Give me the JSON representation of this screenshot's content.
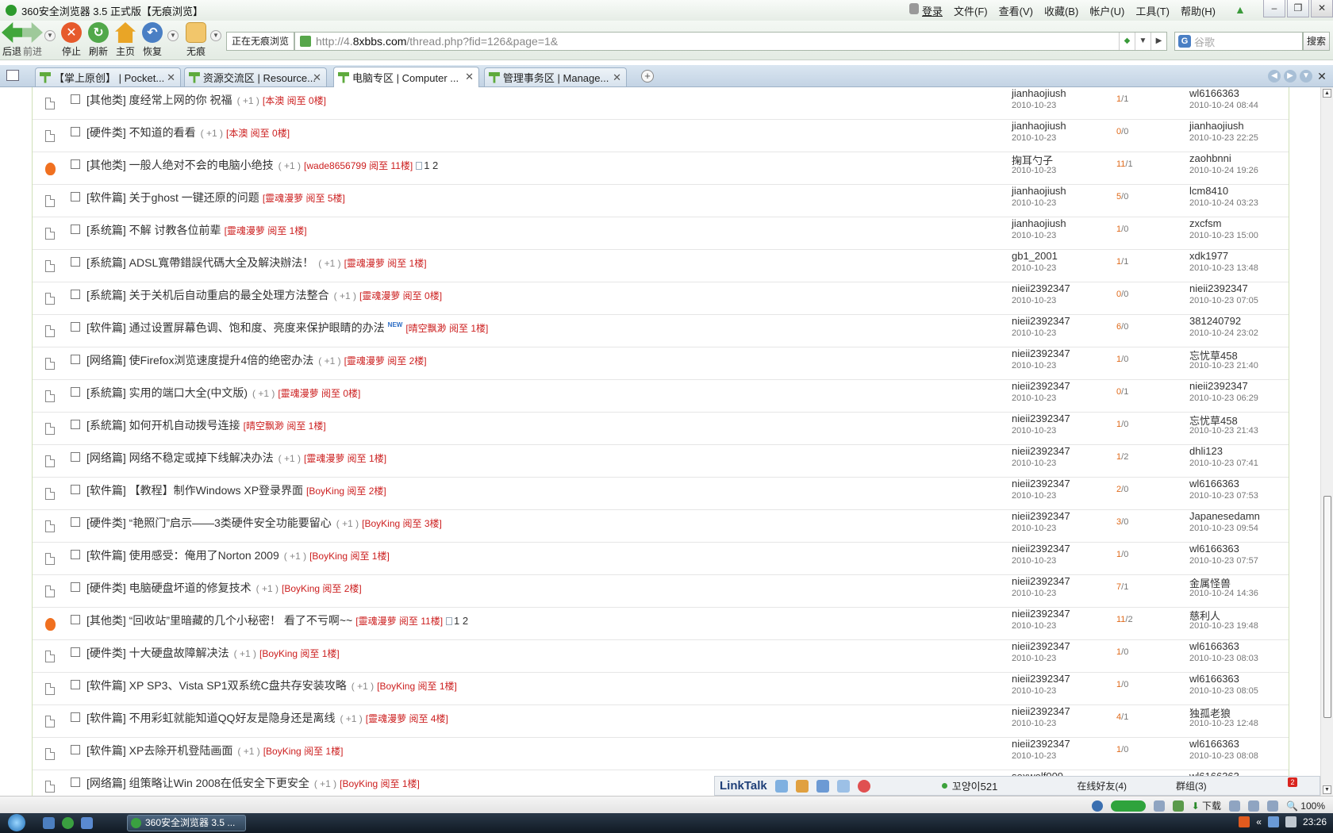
{
  "window": {
    "title": "360安全浏览器 3.5 正式版【无痕浏览】",
    "menus": [
      "登录",
      "文件(F)",
      "查看(V)",
      "收藏(B)",
      "帐户(U)",
      "工具(T)",
      "帮助(H)"
    ]
  },
  "toolbar": {
    "back": "后退",
    "forward": "前进",
    "stop": "停止",
    "refresh": "刷新",
    "home": "主页",
    "restore": "恢复",
    "traceless": "无痕",
    "incognito_badge": "正在无痕浏览",
    "url_prefix": "http://4.",
    "url_domain": "8xbbs.com",
    "url_path": "/thread.php?fid=126&page=1&",
    "search_placeholder": "谷歌",
    "search_button": "搜索"
  },
  "tabs": [
    {
      "label": "【掌上原创】 | Pocket...",
      "active": false
    },
    {
      "label": "资源交流区 | Resource...",
      "active": false
    },
    {
      "label": "电脑专区 | Computer ...",
      "active": true
    },
    {
      "label": "管理事务区 | Manage...",
      "active": false
    }
  ],
  "threads": [
    {
      "hot": false,
      "cat": "[其他类]",
      "subject": "度经常上网的你  祝福",
      "plus": "( +1 )",
      "lastread": "[本澳 阅至 0楼]",
      "pages": "",
      "new": false,
      "author": "jianhaojiush",
      "adate": "2010-10-23",
      "replies": "1",
      "views": "1",
      "lastuser": "wl6166363",
      "ldate": "2010-10-24 08:44"
    },
    {
      "hot": false,
      "cat": "[硬件类]",
      "subject": "不知道的看看",
      "plus": "( +1 )",
      "lastread": "[本澳 阅至 0楼]",
      "pages": "",
      "new": false,
      "author": "jianhaojiush",
      "adate": "2010-10-23",
      "replies": "0",
      "views": "0",
      "lastuser": "jianhaojiush",
      "ldate": "2010-10-23 22:25"
    },
    {
      "hot": true,
      "cat": "[其他类]",
      "subject": "一般人绝对不会的电脑小绝技",
      "plus": "( +1 )",
      "lastread": "[wade8656799 阅至 11楼]",
      "pages": "1 2",
      "new": false,
      "author": "掬耳勺子",
      "adate": "2010-10-23",
      "replies": "11",
      "views": "1",
      "lastuser": "zaohbnni",
      "ldate": "2010-10-24 19:26"
    },
    {
      "hot": false,
      "cat": "[软件篇]",
      "subject": "关于ghost  一键还原的问题",
      "plus": "",
      "lastread": "[靈魂漫萝 阅至 5楼]",
      "pages": "",
      "new": false,
      "author": "jianhaojiush",
      "adate": "2010-10-23",
      "replies": "5",
      "views": "0",
      "lastuser": "lcm8410",
      "ldate": "2010-10-24 03:23"
    },
    {
      "hot": false,
      "cat": "[系统篇]",
      "subject": "不解  讨教各位前辈",
      "plus": "",
      "lastread": "[靈魂漫萝 阅至 1楼]",
      "pages": "",
      "new": false,
      "author": "jianhaojiush",
      "adate": "2010-10-23",
      "replies": "1",
      "views": "0",
      "lastuser": "zxcfsm",
      "ldate": "2010-10-23 15:00"
    },
    {
      "hot": false,
      "cat": "[系統篇]",
      "subject": "ADSL寬帶錯誤代碼大全及解決辦法！",
      "plus": "( +1 )",
      "lastread": "[靈魂漫萝 阅至 1楼]",
      "pages": "",
      "new": false,
      "author": "gb1_2001",
      "adate": "2010-10-23",
      "replies": "1",
      "views": "1",
      "lastuser": "xdk1977",
      "ldate": "2010-10-23 13:48"
    },
    {
      "hot": false,
      "cat": "[系統篇]",
      "subject": "关于关机后自动重启的最全处理方法整合",
      "plus": "( +1 )",
      "lastread": "[靈魂漫萝 阅至 0楼]",
      "pages": "",
      "new": false,
      "author": "nieii2392347",
      "adate": "2010-10-23",
      "replies": "0",
      "views": "0",
      "lastuser": "nieii2392347",
      "ldate": "2010-10-23 07:05"
    },
    {
      "hot": false,
      "cat": "[软件篇]",
      "subject": "通过设置屏幕色调、饱和度、亮度来保护眼睛的办法",
      "plus": "",
      "lastread": "[晴空飘渺 阅至 1楼]",
      "pages": "",
      "new": true,
      "author": "nieii2392347",
      "adate": "2010-10-23",
      "replies": "6",
      "views": "0",
      "lastuser": "381240792",
      "ldate": "2010-10-24 23:02"
    },
    {
      "hot": false,
      "cat": "[网络篇]",
      "subject": "使Firefox浏览速度提升4倍的绝密办法",
      "plus": "( +1 )",
      "lastread": "[靈魂漫萝 阅至 2楼]",
      "pages": "",
      "new": false,
      "author": "nieii2392347",
      "adate": "2010-10-23",
      "replies": "1",
      "views": "0",
      "lastuser": "忘忧草458",
      "ldate": "2010-10-23 21:40"
    },
    {
      "hot": false,
      "cat": "[系統篇]",
      "subject": "实用的端口大全(中文版)",
      "plus": "( +1 )",
      "lastread": "[靈魂漫萝 阅至 0楼]",
      "pages": "",
      "new": false,
      "author": "nieii2392347",
      "adate": "2010-10-23",
      "replies": "0",
      "views": "1",
      "lastuser": "nieii2392347",
      "ldate": "2010-10-23 06:29"
    },
    {
      "hot": false,
      "cat": "[系統篇]",
      "subject": "如何开机自动拨号连接",
      "plus": "",
      "lastread": "[晴空飘渺 阅至 1楼]",
      "pages": "",
      "new": false,
      "author": "nieii2392347",
      "adate": "2010-10-23",
      "replies": "1",
      "views": "0",
      "lastuser": "忘忧草458",
      "ldate": "2010-10-23 21:43"
    },
    {
      "hot": false,
      "cat": "[网络篇]",
      "subject": "网络不稳定或掉下线解决办法",
      "plus": "( +1 )",
      "lastread": "[靈魂漫萝 阅至 1楼]",
      "pages": "",
      "new": false,
      "author": "nieii2392347",
      "adate": "2010-10-23",
      "replies": "1",
      "views": "2",
      "lastuser": "dhli123",
      "ldate": "2010-10-23 07:41"
    },
    {
      "hot": false,
      "cat": "[软件篇]",
      "subject": "【教程】制作Windows XP登录界面",
      "plus": "",
      "lastread": "[BoyKing 阅至 2楼]",
      "pages": "",
      "new": false,
      "author": "nieii2392347",
      "adate": "2010-10-23",
      "replies": "2",
      "views": "0",
      "lastuser": "wl6166363",
      "ldate": "2010-10-23 07:53"
    },
    {
      "hot": false,
      "cat": "[硬件类]",
      "subject": "“艳照门”启示——3类硬件安全功能要留心",
      "plus": "( +1 )",
      "lastread": "[BoyKing 阅至 3楼]",
      "pages": "",
      "new": false,
      "author": "nieii2392347",
      "adate": "2010-10-23",
      "replies": "3",
      "views": "0",
      "lastuser": "Japanesedamn",
      "ldate": "2010-10-23 09:54"
    },
    {
      "hot": false,
      "cat": "[软件篇]",
      "subject": "使用感受：俺用了Norton 2009",
      "plus": "( +1 )",
      "lastread": "[BoyKing 阅至 1楼]",
      "pages": "",
      "new": false,
      "author": "nieii2392347",
      "adate": "2010-10-23",
      "replies": "1",
      "views": "0",
      "lastuser": "wl6166363",
      "ldate": "2010-10-23 07:57"
    },
    {
      "hot": false,
      "cat": "[硬件类]",
      "subject": "电脑硬盘坏道的修复技术",
      "plus": "( +1 )",
      "lastread": "[BoyKing 阅至 2楼]",
      "pages": "",
      "new": false,
      "author": "nieii2392347",
      "adate": "2010-10-23",
      "replies": "7",
      "views": "1",
      "lastuser": "金属怪兽",
      "ldate": "2010-10-24 14:36"
    },
    {
      "hot": true,
      "cat": "[其他类]",
      "subject": "“回收站”里暗藏的几个小秘密！  看了不亏啊~~",
      "plus": "",
      "lastread": "[靈魂漫萝 阅至 11楼]",
      "pages": "1 2",
      "new": false,
      "author": "nieii2392347",
      "adate": "2010-10-23",
      "replies": "11",
      "views": "2",
      "lastuser": "慈利人",
      "ldate": "2010-10-23 19:48"
    },
    {
      "hot": false,
      "cat": "[硬件类]",
      "subject": "十大硬盘故障解决法",
      "plus": "( +1 )",
      "lastread": "[BoyKing 阅至 1楼]",
      "pages": "",
      "new": false,
      "author": "nieii2392347",
      "adate": "2010-10-23",
      "replies": "1",
      "views": "0",
      "lastuser": "wl6166363",
      "ldate": "2010-10-23 08:03"
    },
    {
      "hot": false,
      "cat": "[软件篇]",
      "subject": "XP SP3、Vista SP1双系统C盘共存安装攻略",
      "plus": "( +1 )",
      "lastread": "[BoyKing 阅至 1楼]",
      "pages": "",
      "new": false,
      "author": "nieii2392347",
      "adate": "2010-10-23",
      "replies": "1",
      "views": "0",
      "lastuser": "wl6166363",
      "ldate": "2010-10-23 08:05"
    },
    {
      "hot": false,
      "cat": "[软件篇]",
      "subject": "不用彩虹就能知道QQ好友是隐身还是离线",
      "plus": "( +1 )",
      "lastread": "[靈魂漫萝 阅至 4楼]",
      "pages": "",
      "new": false,
      "author": "nieii2392347",
      "adate": "2010-10-23",
      "replies": "4",
      "views": "1",
      "lastuser": "独孤老狼",
      "ldate": "2010-10-23 12:48"
    },
    {
      "hot": false,
      "cat": "[软件篇]",
      "subject": "XP去除开机登陆画面",
      "plus": "( +1 )",
      "lastread": "[BoyKing 阅至 1楼]",
      "pages": "",
      "new": false,
      "author": "nieii2392347",
      "adate": "2010-10-23",
      "replies": "1",
      "views": "0",
      "lastuser": "wl6166363",
      "ldate": "2010-10-23 08:08"
    },
    {
      "hot": false,
      "cat": "[网络篇]",
      "subject": "组策略让Win 2008在低安全下更安全",
      "plus": "( +1 )",
      "lastread": "[BoyKing 阅至 1楼]",
      "pages": "",
      "new": false,
      "author": "sexwolf009",
      "adate": "",
      "replies": "",
      "views": "",
      "lastuser": "wl6166363",
      "ldate": ""
    }
  ],
  "linktalk": {
    "brand": "LinkTalk",
    "user": "꼬양이521",
    "friends": "在线好友(4)",
    "groups": "群组(3)",
    "badge": "2"
  },
  "statusbar": {
    "download": "下载",
    "zoom": "100%"
  },
  "taskbar": {
    "item": "360安全浏览器 3.5 ...",
    "time": "23:26"
  }
}
